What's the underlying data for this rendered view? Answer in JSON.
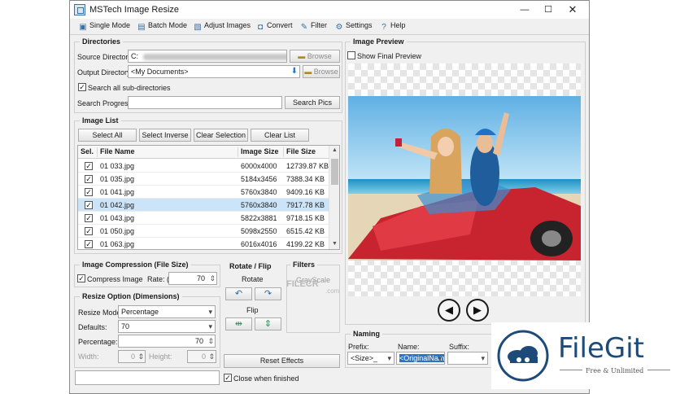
{
  "window": {
    "title": "MSTech Image Resize",
    "controls": {
      "minimize": "—",
      "maximize": "☐",
      "close": "✕"
    }
  },
  "toolbar": [
    {
      "label": "Single Mode",
      "icon": "single-mode-icon"
    },
    {
      "label": "Batch Mode",
      "icon": "batch-mode-icon"
    },
    {
      "label": "Adjust Images",
      "icon": "adjust-images-icon"
    },
    {
      "label": "Convert",
      "icon": "convert-icon"
    },
    {
      "label": "Filter",
      "icon": "filter-icon"
    },
    {
      "label": "Settings",
      "icon": "gear-icon"
    },
    {
      "label": "Help",
      "icon": "help-icon"
    }
  ],
  "directories": {
    "title": "Directories",
    "source_label": "Source Directory:",
    "source_value": "C:",
    "output_label": "Output Directory:",
    "output_value": "<My Documents>",
    "browse_label": "Browse",
    "search_all_label": "Search all sub-directories",
    "search_all_checked": true,
    "progress_label": "Search Progress:",
    "progress_value": "",
    "search_button": "Search Pics"
  },
  "image_list": {
    "title": "Image List",
    "buttons": [
      "Select All",
      "Select Inverse",
      "Clear Selection",
      "Clear List"
    ],
    "columns": [
      "Sel.",
      "File Name",
      "Image Size",
      "File Size"
    ],
    "rows": [
      {
        "checked": true,
        "name": "01 033.jpg",
        "size": "6000x4000",
        "file_size": "12739.87 KB",
        "selected": false
      },
      {
        "checked": true,
        "name": "01 035.jpg",
        "size": "5184x3456",
        "file_size": "7388.34 KB",
        "selected": false
      },
      {
        "checked": true,
        "name": "01 041.jpg",
        "size": "5760x3840",
        "file_size": "9409.16 KB",
        "selected": false
      },
      {
        "checked": true,
        "name": "01 042.jpg",
        "size": "5760x3840",
        "file_size": "7917.78 KB",
        "selected": true
      },
      {
        "checked": true,
        "name": "01 043.jpg",
        "size": "5822x3881",
        "file_size": "9718.15 KB",
        "selected": false
      },
      {
        "checked": true,
        "name": "01 050.jpg",
        "size": "5098x2550",
        "file_size": "6515.42 KB",
        "selected": false
      },
      {
        "checked": true,
        "name": "01 063.jpg",
        "size": "6016x4016",
        "file_size": "4199.22 KB",
        "selected": false
      }
    ]
  },
  "compression": {
    "title": "Image Compression (File Size)",
    "compress_label": "Compress Image",
    "compress_checked": true,
    "rate_label": "Rate: (%)",
    "rate_value": "70"
  },
  "rotate": {
    "title": "Rotate / Flip",
    "rotate_label": "Rotate",
    "flip_label": "Flip"
  },
  "filters": {
    "title": "Filters",
    "grayscale_label": "GrayScale"
  },
  "resize": {
    "title": "Resize Option (Dimensions)",
    "mode_label": "Resize Mode:",
    "mode_value": "Percentage",
    "defaults_label": "Defaults:",
    "defaults_value": "70",
    "percentage_label": "Percentage:",
    "percentage_value": "70",
    "width_label": "Width:",
    "width_value": "0",
    "height_label": "Height:",
    "height_value": "0"
  },
  "reset_button": "Reset Effects",
  "bottom": {
    "status_value": "",
    "close_when_finished_label": "Close when finished",
    "close_when_finished_checked": true
  },
  "preview": {
    "title": "Image Preview",
    "show_final_label": "Show Final Preview",
    "show_final_checked": false,
    "prev": "◀",
    "next": "▶"
  },
  "naming": {
    "title": "Naming",
    "prefix_label": "Prefix:",
    "prefix_value": "<Size>_",
    "name_label": "Name:",
    "name_value": "<OriginalNam",
    "suffix_label": "Suffix:",
    "suffix_value": ""
  },
  "watermark": {
    "filecr_text": "FILECR",
    "filecr_sub": ".com",
    "filegit_name": "FileGit",
    "filegit_tagline": "Free & Unlimited"
  },
  "colors": {
    "selection": "#cce4f7",
    "filegit_blue": "#1e4a7a",
    "car_red": "#d32b36",
    "sky": "#8cc8ec"
  }
}
